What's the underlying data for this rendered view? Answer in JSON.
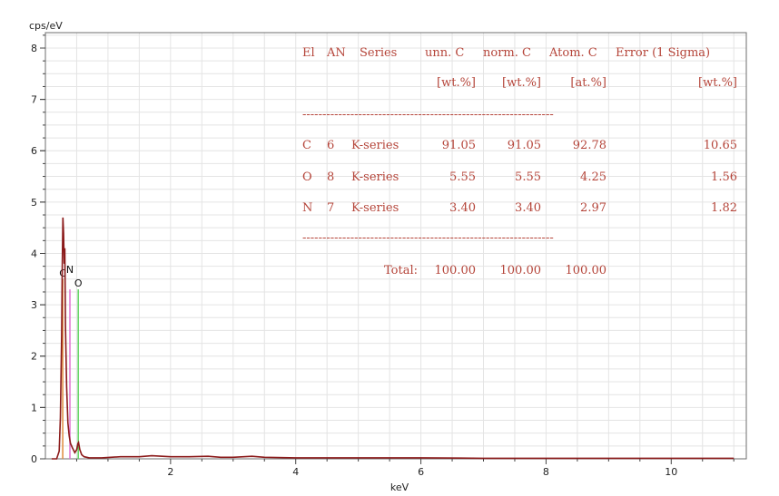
{
  "chart_data": {
    "type": "line",
    "xlabel": "keV",
    "ylabel": "cps/eV",
    "xlim": [
      0,
      11.2
    ],
    "ylim": [
      0,
      8.3
    ],
    "xticks": [
      2,
      4,
      6,
      8,
      10
    ],
    "yticks": [
      0,
      1,
      2,
      3,
      4,
      5,
      6,
      7,
      8
    ],
    "grid": true,
    "spectrum": {
      "color": "#8b1a1a",
      "x": [
        0.1,
        0.18,
        0.22,
        0.24,
        0.26,
        0.27,
        0.28,
        0.29,
        0.3,
        0.31,
        0.32,
        0.34,
        0.36,
        0.38,
        0.4,
        0.43,
        0.47,
        0.5,
        0.52,
        0.53,
        0.55,
        0.58,
        0.62,
        0.7,
        0.9,
        1.2,
        1.5,
        1.7,
        2.0,
        2.3,
        2.6,
        2.8,
        3.0,
        3.3,
        3.5,
        4.0,
        5.0,
        6.0,
        7.0,
        8.0,
        9.0,
        10.0,
        11.0
      ],
      "y": [
        0.0,
        0.0,
        0.15,
        0.8,
        2.4,
        3.8,
        4.7,
        4.4,
        3.8,
        4.1,
        2.6,
        1.4,
        0.7,
        0.45,
        0.3,
        0.22,
        0.12,
        0.18,
        0.3,
        0.32,
        0.18,
        0.08,
        0.04,
        0.02,
        0.02,
        0.04,
        0.04,
        0.06,
        0.04,
        0.04,
        0.05,
        0.03,
        0.03,
        0.05,
        0.03,
        0.02,
        0.02,
        0.02,
        0.01,
        0.01,
        0.01,
        0.01,
        0.01
      ]
    },
    "markers": [
      {
        "label": "C",
        "x": 0.277,
        "height": 3.5,
        "color": "#e08a3c"
      },
      {
        "label": "N",
        "x": 0.392,
        "height": 3.3,
        "color": "#e070d0"
      },
      {
        "label": "O",
        "x": 0.525,
        "height": 3.3,
        "color": "#5fd35f"
      }
    ],
    "table": {
      "header": [
        "El",
        "AN",
        "Series",
        "unn. C",
        "norm. C",
        "Atom. C",
        "Error (1 Sigma)"
      ],
      "units": [
        "",
        "",
        "",
        "[wt.%]",
        "[wt.%]",
        "[at.%]",
        "[wt.%]"
      ],
      "rows": [
        [
          "C",
          "6",
          "K-series",
          "91.05",
          "91.05",
          "92.78",
          "10.65"
        ],
        [
          "O",
          "8",
          "K-series",
          "5.55",
          "5.55",
          "4.25",
          "1.56"
        ],
        [
          "N",
          "7",
          "K-series",
          "3.40",
          "3.40",
          "2.97",
          "1.82"
        ]
      ],
      "total_label": "Total:",
      "totals": [
        "100.00",
        "100.00",
        "100.00"
      ],
      "separator": "---------------------------------------------------------------",
      "color": "#b5453a"
    }
  }
}
